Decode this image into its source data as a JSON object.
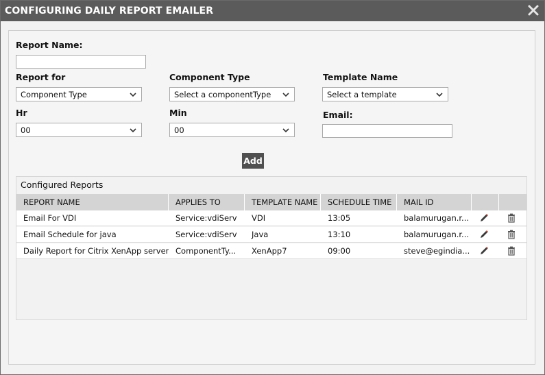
{
  "dialog": {
    "title": "CONFIGURING DAILY REPORT EMAILER",
    "close_icon": "close-icon"
  },
  "form": {
    "report_name_label": "Report Name:",
    "report_name_value": "",
    "report_for_label": "Report for",
    "report_for_value": "Component Type",
    "component_type_label": "Component Type",
    "component_type_value": "Select a componentType",
    "template_name_label": "Template Name",
    "template_name_value": "Select a template",
    "hr_label": "Hr",
    "hr_value": "00",
    "min_label": "Min",
    "min_value": "00",
    "email_label": "Email:",
    "email_value": "",
    "add_label": "Add"
  },
  "configured": {
    "title": "Configured Reports",
    "columns": [
      "REPORT NAME",
      "APPLIES TO",
      "TEMPLATE NAME",
      "SCHEDULE TIME",
      "MAIL ID"
    ],
    "rows": [
      {
        "name": "Email For VDI",
        "applies": "Service:vdiServ",
        "template": "VDI",
        "time": "13:05",
        "mail": "balamurugan.r..."
      },
      {
        "name": "Email Schedule for java",
        "applies": "Service:vdiServ",
        "template": "Java",
        "time": "13:10",
        "mail": "balamurugan.r..."
      },
      {
        "name": "Daily Report for Citrix XenApp server",
        "applies": "ComponentTy...",
        "template": "XenApp7",
        "time": "09:00",
        "mail": "steve@egindia..."
      }
    ]
  },
  "colors": {
    "titlebar": "#5b5b5b",
    "header": "#d4d4d4",
    "edit_icon_tip": "#d23a2a"
  }
}
